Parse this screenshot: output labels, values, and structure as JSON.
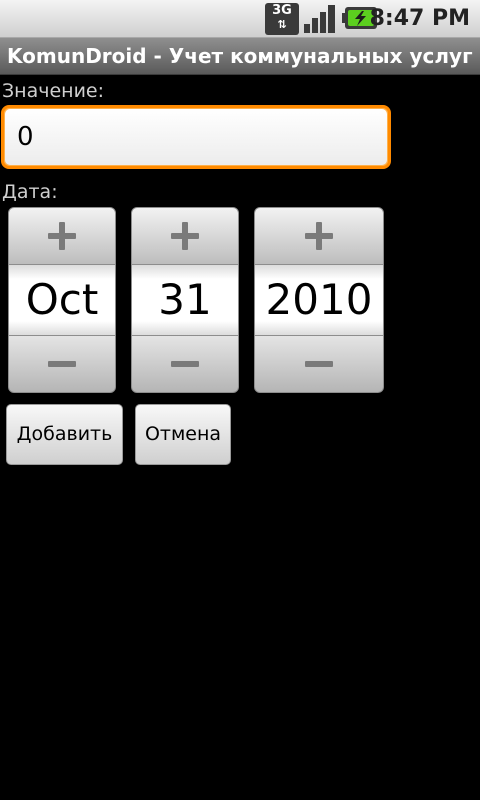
{
  "status_bar": {
    "network_label": "3G",
    "network_arrows": "⇅",
    "time": "8:47 PM"
  },
  "app": {
    "title": "KomunDroid - Учет коммунальных услуг"
  },
  "form": {
    "value_label": "Значение:",
    "value_input": "0",
    "date_label": "Дата:",
    "date": {
      "month": "Oct",
      "day": "31",
      "year": "2010"
    },
    "add_label": "Добавить",
    "cancel_label": "Отмена"
  },
  "colors": {
    "focus_border": "#ff8a00",
    "background": "#000000",
    "battery_green": "#5ccf1f"
  },
  "icons": {
    "increment": "plus-icon",
    "decrement": "minus-icon",
    "signal": "signal-bars-icon",
    "battery": "battery-charging-icon"
  }
}
